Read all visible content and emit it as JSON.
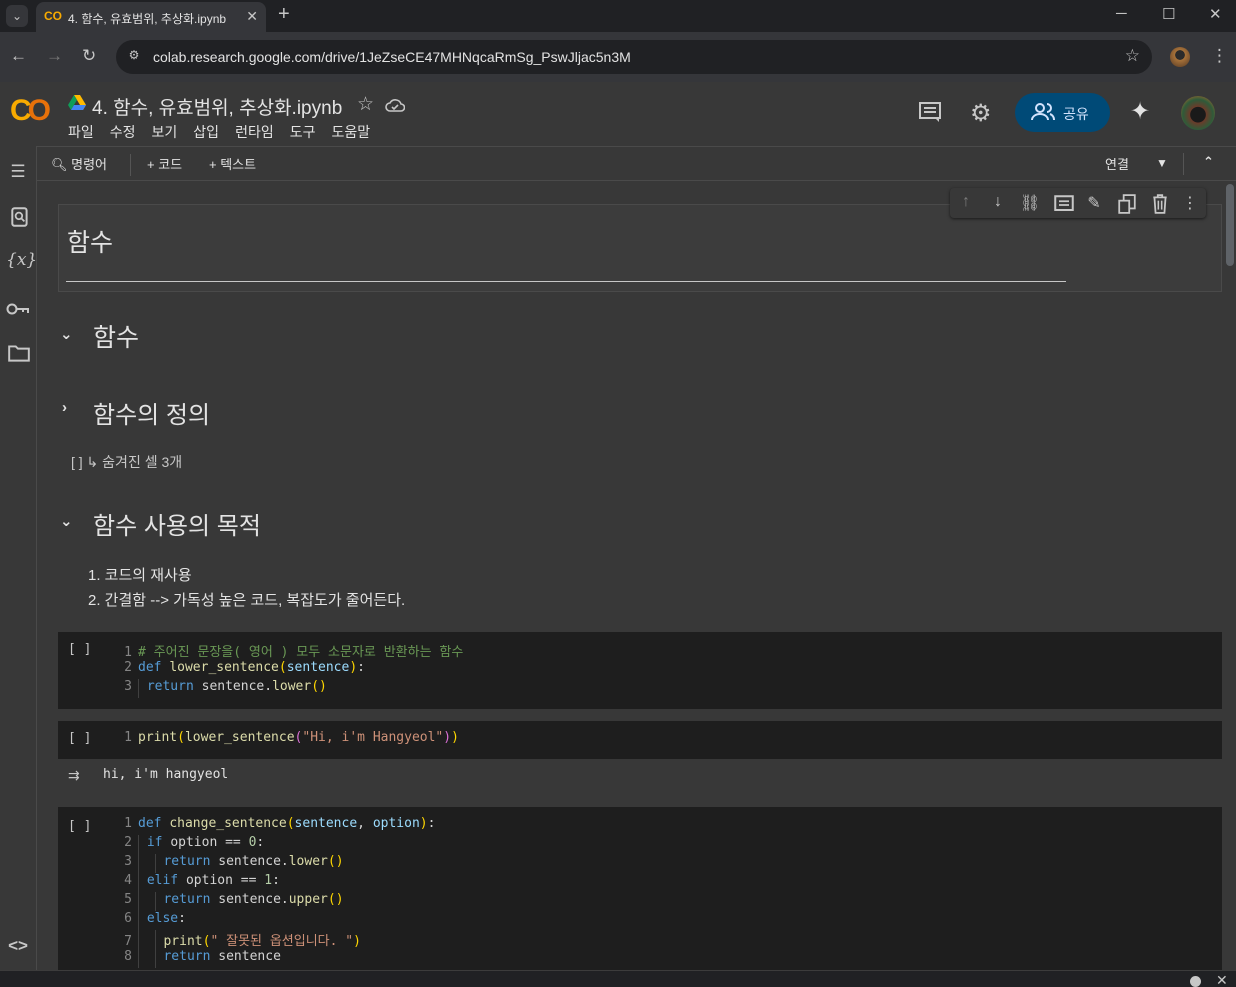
{
  "browser": {
    "tab_title": "4. 함수, 유효범위, 추상화.ipynb",
    "tab_close": "✕",
    "new_tab": "+",
    "url": "colab.research.google.com/drive/1JeZseCE47MHNqcaRmSg_PswJljac5n3M",
    "window_controls": [
      "─",
      "☐",
      "✕"
    ]
  },
  "colab": {
    "logo_text": "CO",
    "doc_title": "4. 함수, 유효범위, 추상화.ipynb",
    "menu": [
      "파일",
      "수정",
      "보기",
      "삽입",
      "런타임",
      "도구",
      "도움말"
    ],
    "share_label": "공유"
  },
  "toolbar": {
    "command_label": "명령어",
    "add_code_label": "+ 코드",
    "add_text_label": "+ 텍스트",
    "connect_label": "연결"
  },
  "left_rail_icons": [
    "toc-icon",
    "find-replace-icon",
    "variables-icon",
    "secrets-icon",
    "files-icon",
    "code-snippets-icon"
  ],
  "cell_toolbar_icons": [
    "move-up-icon",
    "move-down-icon",
    "link-icon",
    "comment-icon",
    "edit-icon",
    "mirror-cell-icon",
    "delete-icon",
    "more-icon"
  ],
  "notebook": {
    "title_cell": "함수",
    "section_functions": "함수",
    "section_definition": "함수의 정의",
    "hidden_cells": "[ ] ↳ 숨겨진 셀 3개",
    "section_purpose": "함수 사용의 목적",
    "purpose_items": [
      "1. 코드의 재사용",
      "2. 간결함 --> 가독성 높은 코드, 복잡도가 줄어든다."
    ],
    "cell1": {
      "run": "[ ]",
      "lines": [
        "1",
        "2",
        "3"
      ],
      "comment": "# 주어진 문장을( 영어 ) 모두 소문자로 반환하는 함수",
      "l2_kw": "def",
      "l2_fn": "lower_sentence",
      "l2_param": "sentence",
      "l3_kw": "return",
      "l3_obj": "sentence",
      "l3_method": "lower"
    },
    "cell2": {
      "run": "[ ]",
      "line": "1",
      "fn": "print",
      "inner_fn": "lower_sentence",
      "str": "\"Hi, i'm Hangyeol\"",
      "output": "hi, i'm hangyeol"
    },
    "cell3": {
      "run": "[ ]",
      "lines": [
        "1",
        "2",
        "3",
        "4",
        "5",
        "6",
        "7",
        "8"
      ],
      "fn": "change_sentence",
      "p1": "sentence",
      "p2": "option",
      "str": "\" 잘못된 옵션입니다. \"",
      "zero": "0",
      "one": "1"
    }
  },
  "colors": {
    "accent": "#f9ab00",
    "share_bg": "#004a77",
    "code_bg": "#1e1e1e",
    "background": "#383838"
  }
}
